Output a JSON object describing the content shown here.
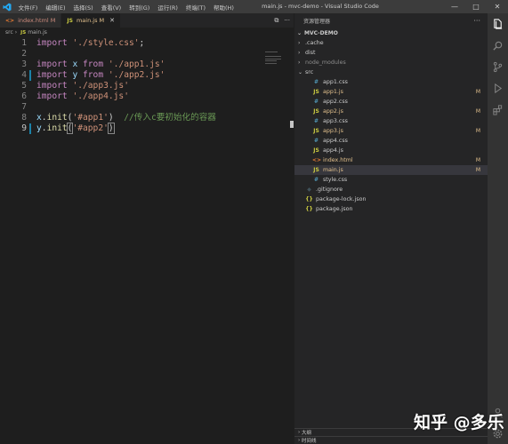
{
  "titlebar": {
    "menu": [
      "文件(F)",
      "编辑(E)",
      "选择(S)",
      "查看(V)",
      "转到(G)",
      "运行(R)",
      "终端(T)",
      "帮助(H)"
    ],
    "title": "main.js - mvc-demo - Visual Studio Code",
    "minimize": "—",
    "maximize": "□",
    "close": "✕"
  },
  "tabs": [
    {
      "icon": "<>",
      "label": "index.html",
      "badge": "M",
      "active": false
    },
    {
      "icon": "JS",
      "label": "main.js",
      "badge": "M",
      "active": true
    }
  ],
  "breadcrumb": {
    "folder": "src",
    "sep": "›",
    "icon": "JS",
    "file": "main.js"
  },
  "code": {
    "line_numbers": [
      "1",
      "2",
      "3",
      "4",
      "5",
      "6",
      "7",
      "8",
      "9"
    ],
    "current_line": "9",
    "comment": "//传入c要初始化的容器"
  },
  "explorer": {
    "header": "资源管理器",
    "more": "···",
    "project": "MVC-DEMO",
    "items": [
      {
        "name": ".cache",
        "type": "folder",
        "indent": 0,
        "badge": ""
      },
      {
        "name": "dist",
        "type": "folder",
        "indent": 0,
        "badge": ""
      },
      {
        "name": "node_modules",
        "type": "folder-dim",
        "indent": 0,
        "badge": ""
      },
      {
        "name": "src",
        "type": "folder-open",
        "indent": 0,
        "badge": ""
      },
      {
        "name": "app1.css",
        "type": "css",
        "indent": 1,
        "badge": ""
      },
      {
        "name": "app1.js",
        "type": "js",
        "indent": 1,
        "badge": "M"
      },
      {
        "name": "app2.css",
        "type": "css",
        "indent": 1,
        "badge": ""
      },
      {
        "name": "app2.js",
        "type": "js",
        "indent": 1,
        "badge": "M"
      },
      {
        "name": "app3.css",
        "type": "css",
        "indent": 1,
        "badge": ""
      },
      {
        "name": "app3.js",
        "type": "js",
        "indent": 1,
        "badge": "M"
      },
      {
        "name": "app4.css",
        "type": "css",
        "indent": 1,
        "badge": ""
      },
      {
        "name": "app4.js",
        "type": "js",
        "indent": 1,
        "badge": ""
      },
      {
        "name": "index.html",
        "type": "html",
        "indent": 1,
        "badge": "M"
      },
      {
        "name": "main.js",
        "type": "js",
        "indent": 1,
        "badge": "M",
        "selected": true
      },
      {
        "name": "style.css",
        "type": "css",
        "indent": 1,
        "badge": ""
      },
      {
        "name": ".gitignore",
        "type": "git",
        "indent": 0,
        "badge": ""
      },
      {
        "name": "package-lock.json",
        "type": "json",
        "indent": 0,
        "badge": ""
      },
      {
        "name": "package.json",
        "type": "json",
        "indent": 0,
        "badge": ""
      }
    ],
    "outline": "大纲",
    "timeline": "时间线"
  },
  "watermark": "知乎 @多乐",
  "colors": {
    "accent": "#007acc",
    "modified": "#e2c08d",
    "keyword": "#c586c0",
    "string": "#ce9178"
  }
}
